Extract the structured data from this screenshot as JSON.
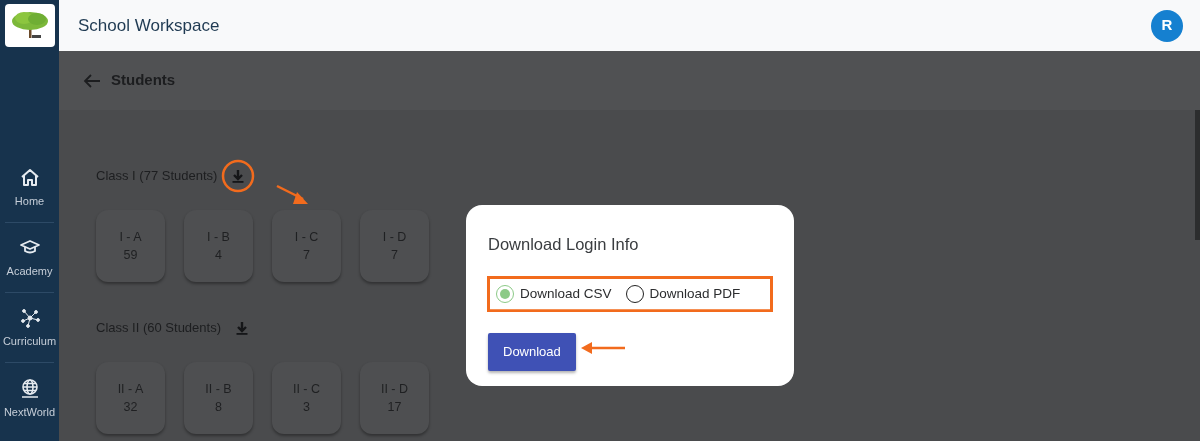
{
  "header": {
    "title": "School Workspace",
    "avatar": "R"
  },
  "sidebar": {
    "items": [
      {
        "kind": "home",
        "label": "Home"
      },
      {
        "kind": "academy",
        "label": "Academy"
      },
      {
        "kind": "curriculum",
        "label": "Curriculum"
      },
      {
        "kind": "world",
        "label": "NextWorld"
      }
    ]
  },
  "page": {
    "title": "Students"
  },
  "classes": [
    {
      "heading": "Class I (77 Students)",
      "highlighted": true,
      "sections": [
        {
          "name": "I - A",
          "count": "59"
        },
        {
          "name": "I - B",
          "count": "4"
        },
        {
          "name": "I - C",
          "count": "7"
        },
        {
          "name": "I - D",
          "count": "7"
        }
      ]
    },
    {
      "heading": "Class II (60 Students)",
      "highlighted": false,
      "sections": [
        {
          "name": "II - A",
          "count": "32"
        },
        {
          "name": "II - B",
          "count": "8"
        },
        {
          "name": "II - C",
          "count": "3"
        },
        {
          "name": "II - D",
          "count": "17"
        }
      ]
    }
  ],
  "dialog": {
    "title": "Download Login Info",
    "options": [
      {
        "label": "Download CSV",
        "selected": true
      },
      {
        "label": "Download PDF",
        "selected": false
      }
    ],
    "button": "Download"
  }
}
